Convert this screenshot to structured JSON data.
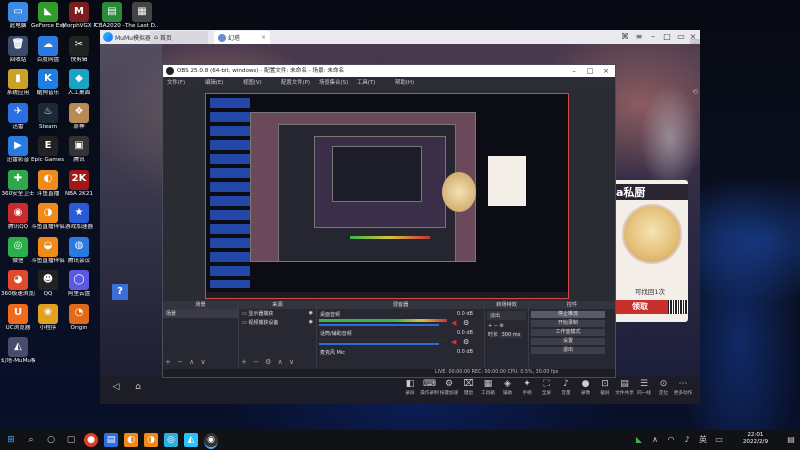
{
  "desktop": {
    "icons": [
      {
        "label": "此电脑",
        "glyph": "▭",
        "color": "#3b8be6"
      },
      {
        "label": "GeForce Experience",
        "glyph": "◣",
        "color": "#2f9d28"
      },
      {
        "label": "MorphVGX Pro",
        "glyph": "M",
        "color": "#7a1e1e"
      },
      {
        "label": "CBA2020 - ...",
        "glyph": "▤",
        "color": "#2a8a3a"
      },
      {
        "label": "The Last D...",
        "glyph": "▦",
        "color": "#444"
      },
      {
        "label": "回收站",
        "glyph": "🗑",
        "color": "#3a4a6a"
      },
      {
        "label": "百度网盘",
        "glyph": "☁",
        "color": "#2a7ae2"
      },
      {
        "label": "快剪辑",
        "glyph": "✂",
        "color": "#222"
      },
      {
        "label": "系统应用",
        "glyph": "▮",
        "color": "#c9a227"
      },
      {
        "label": "酷狗音乐",
        "glyph": "K",
        "color": "#1e7fe0"
      },
      {
        "label": "人工桌面",
        "glyph": "◆",
        "color": "#1aa3c4"
      },
      {
        "label": "迅雷",
        "glyph": "✈",
        "color": "#2a6ee0"
      },
      {
        "label": "Steam",
        "glyph": "♨",
        "color": "#1b2838"
      },
      {
        "label": "原神",
        "glyph": "❖",
        "color": "#b88a54"
      },
      {
        "label": "迅雷影音",
        "glyph": "▶",
        "color": "#2a7be0"
      },
      {
        "label": "Epic Games Launcher",
        "glyph": "E",
        "color": "#222"
      },
      {
        "label": "腾讯",
        "glyph": "▣",
        "color": "#333"
      },
      {
        "label": "360安全卫士",
        "glyph": "✚",
        "color": "#2ea84a"
      },
      {
        "label": "斗鱼直播",
        "glyph": "◐",
        "color": "#f08a1a"
      },
      {
        "label": "NBA 2K21",
        "glyph": "2K",
        "color": "#a01818"
      },
      {
        "label": "腾讯QQ",
        "glyph": "◉",
        "color": "#c92a2a"
      },
      {
        "label": "斗鱼直播伴侣",
        "glyph": "◑",
        "color": "#f08a1a"
      },
      {
        "label": "游戏加速器",
        "glyph": "★",
        "color": "#2a5ad8"
      },
      {
        "label": "微信",
        "glyph": "◎",
        "color": "#2ab04a"
      },
      {
        "label": "斗鱼直播伴侣",
        "glyph": "◒",
        "color": "#f08a1a"
      },
      {
        "label": "腾讯会议",
        "glyph": "◍",
        "color": "#2a7be0"
      },
      {
        "label": "360极速浏览器",
        "glyph": "◕",
        "color": "#e04a2a"
      },
      {
        "label": "QQ",
        "glyph": "☻",
        "color": "#222"
      },
      {
        "label": "阿里云盘",
        "glyph": "◯",
        "color": "#5a5ae0"
      },
      {
        "label": "UC浏览器",
        "glyph": "U",
        "color": "#f06a1a"
      },
      {
        "label": "小程序",
        "glyph": "❀",
        "color": "#e0a020"
      },
      {
        "label": "Origin",
        "glyph": "◔",
        "color": "#e06a1a"
      },
      {
        "label": "幻塔-MuMu模拟器",
        "glyph": "◭",
        "color": "#4a4a6a"
      }
    ]
  },
  "mumu": {
    "app_name": "MuMu模拟器",
    "tab_home": "首页",
    "tab_game": "幻塔",
    "game": {
      "help_glyph": "?",
      "card_title": "a私厨",
      "retrieve_text": "可找回1次",
      "claim_label": "领取"
    },
    "bottom_toolbar": [
      {
        "label": "录屏",
        "glyph": "◧"
      },
      {
        "label": "操作录制",
        "glyph": "⌨"
      },
      {
        "label": "按键加速",
        "glyph": "⚙"
      },
      {
        "label": "键鼠",
        "glyph": "⌧"
      },
      {
        "label": "工具箱",
        "glyph": "▦"
      },
      {
        "label": "辅助",
        "glyph": "◈"
      },
      {
        "label": "手柄",
        "glyph": "✦"
      },
      {
        "label": "全屏",
        "glyph": "⛶"
      },
      {
        "label": "音量",
        "glyph": "♪"
      },
      {
        "label": "录像",
        "glyph": "●"
      },
      {
        "label": "截屏",
        "glyph": "⊡"
      },
      {
        "label": "文件共享",
        "glyph": "▤"
      },
      {
        "label": "同一线",
        "glyph": "☰"
      },
      {
        "label": "定位",
        "glyph": "⊙"
      },
      {
        "label": "更多动作",
        "glyph": "⋯"
      }
    ]
  },
  "obs": {
    "title": "OBS 25.0.8 (64-bit, windows) - 配置文件: 未命名 - 场景: 未命名",
    "menu": [
      "文件(F)",
      "编辑(E)",
      "视图(V)",
      "配置文件(P)",
      "场景集合(S)",
      "工具(T)",
      "帮助(H)"
    ],
    "docks": {
      "scenes": {
        "title": "场景",
        "item": "场景"
      },
      "sources": {
        "title": "来源",
        "items": [
          "显示器捕获",
          "视频捕获设备"
        ]
      },
      "mixer": {
        "title": "混音器",
        "channels": [
          {
            "name": "桌面音频",
            "db": "0.0 dB"
          },
          {
            "name": "话筒/辅助音频",
            "db": "0.0 dB"
          },
          {
            "name": "麦克风 Mic",
            "db": "0.0 dB"
          }
        ]
      },
      "transitions": {
        "title": "转场特效",
        "type": "淡出",
        "duration_label": "时长",
        "duration": "300 ms"
      },
      "controls": {
        "title": "控件",
        "buttons": [
          "停止推流",
          "开始录制",
          "工作室模式",
          "设置",
          "退出"
        ]
      }
    },
    "status": "LIVE: 00:00:00   REC: 00:00:00   CPU: 0.5%, 30.00 fps"
  },
  "taskbar": {
    "time": "22:01",
    "date": "2022/2/9"
  }
}
